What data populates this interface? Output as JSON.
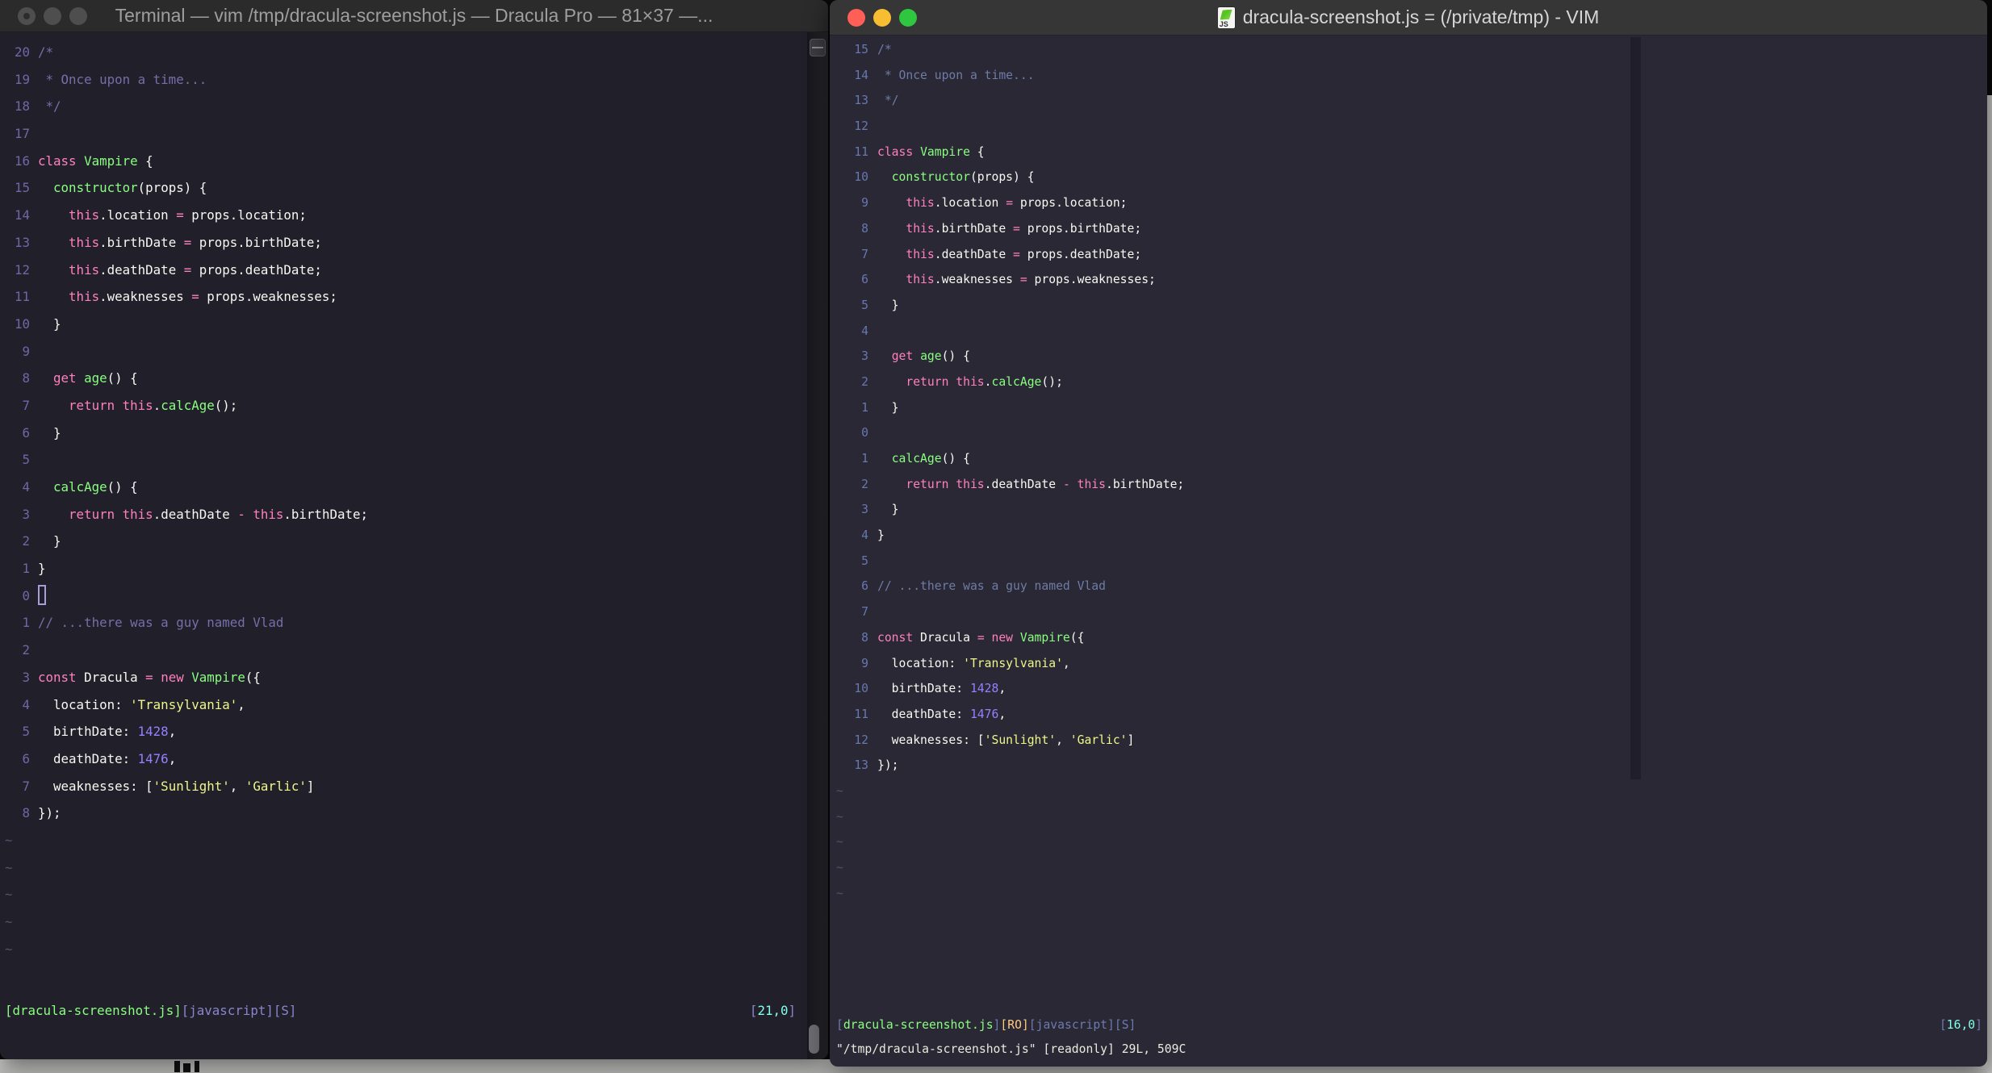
{
  "colors": {
    "bg_left": "#201f2a",
    "bg_right": "#292834",
    "fg": "#f8f8f2",
    "pink": "#ff80bf",
    "green": "#8aff80",
    "yellow": "#eef78a",
    "purple": "#9580ff",
    "cyan": "#80ffea",
    "orange": "#ffca80",
    "comment_left": "#766fa8",
    "comment_right": "#6e7ca6",
    "linenr_left": "#6f68a5",
    "linenr_right": "#6877b0",
    "lavender": "#8a85cc",
    "status_blue": "#6d7ab0",
    "tilde_left": "#54516a",
    "tilde_right": "#4b5270",
    "titlebar_left": "#2c2b2b",
    "titlebar_right": "#373636",
    "colorcolumn": "#211e2b"
  },
  "left_window": {
    "title": "Terminal — vim /tmp/dracula-screenshot.js — Dracula Pro — 81×37 —...",
    "status_tokens": [
      [
        "g",
        "[dracula-screenshot.js]"
      ],
      [
        "lav",
        "[javascript][S]"
      ]
    ],
    "position_tokens": [
      [
        "lav",
        "["
      ],
      [
        "cy",
        "21,0"
      ],
      [
        "lav",
        "]"
      ]
    ],
    "tilde_count": 5,
    "cursor_line_index": 20
  },
  "right_window": {
    "title": "dracula-screenshot.js = (/private/tmp) - VIM",
    "status_tokens": [
      [
        "b",
        "["
      ],
      [
        "g",
        "dracula-screenshot.js"
      ],
      [
        "b",
        "]"
      ],
      [
        "o",
        "[RO]"
      ],
      [
        "b",
        "[javascript][S]"
      ]
    ],
    "position_tokens": [
      [
        "b",
        "["
      ],
      [
        "cy",
        "16,0"
      ],
      [
        "b",
        "]"
      ]
    ],
    "message_line": "\"/tmp/dracula-screenshot.js\" [readonly] 29L, 509C",
    "tilde_count": 5,
    "cursor_visible": false
  },
  "tilde_glyph": "~",
  "code": {
    "lines": [
      {
        "l": "20",
        "r": "15",
        "tokens": [
          [
            "c",
            "/*"
          ]
        ]
      },
      {
        "l": "19",
        "r": "14",
        "tokens": [
          [
            "c",
            " * Once upon a time..."
          ]
        ]
      },
      {
        "l": "18",
        "r": "13",
        "tokens": [
          [
            "c",
            " */"
          ]
        ]
      },
      {
        "l": "17",
        "r": "12",
        "tokens": []
      },
      {
        "l": "16",
        "r": "11",
        "tokens": [
          [
            "p",
            "class"
          ],
          [
            "n",
            " "
          ],
          [
            "g",
            "Vampire"
          ],
          [
            "n",
            " {"
          ]
        ]
      },
      {
        "l": "15",
        "r": "10",
        "tokens": [
          [
            "n",
            "  "
          ],
          [
            "g",
            "constructor"
          ],
          [
            "n",
            "(props) {"
          ]
        ]
      },
      {
        "l": "14",
        "r": "9",
        "tokens": [
          [
            "n",
            "    "
          ],
          [
            "p",
            "this"
          ],
          [
            "n",
            ".location "
          ],
          [
            "p",
            "="
          ],
          [
            "n",
            " props.location;"
          ]
        ]
      },
      {
        "l": "13",
        "r": "8",
        "tokens": [
          [
            "n",
            "    "
          ],
          [
            "p",
            "this"
          ],
          [
            "n",
            ".birthDate "
          ],
          [
            "p",
            "="
          ],
          [
            "n",
            " props.birthDate;"
          ]
        ]
      },
      {
        "l": "12",
        "r": "7",
        "tokens": [
          [
            "n",
            "    "
          ],
          [
            "p",
            "this"
          ],
          [
            "n",
            ".deathDate "
          ],
          [
            "p",
            "="
          ],
          [
            "n",
            " props.deathDate;"
          ]
        ]
      },
      {
        "l": "11",
        "r": "6",
        "tokens": [
          [
            "n",
            "    "
          ],
          [
            "p",
            "this"
          ],
          [
            "n",
            ".weaknesses "
          ],
          [
            "p",
            "="
          ],
          [
            "n",
            " props.weaknesses;"
          ]
        ]
      },
      {
        "l": "10",
        "r": "5",
        "tokens": [
          [
            "n",
            "  }"
          ]
        ]
      },
      {
        "l": "9",
        "r": "4",
        "tokens": []
      },
      {
        "l": "8",
        "r": "3",
        "tokens": [
          [
            "n",
            "  "
          ],
          [
            "p",
            "get"
          ],
          [
            "n",
            " "
          ],
          [
            "g",
            "age"
          ],
          [
            "n",
            "() {"
          ]
        ]
      },
      {
        "l": "7",
        "r": "2",
        "tokens": [
          [
            "n",
            "    "
          ],
          [
            "p",
            "return"
          ],
          [
            "n",
            " "
          ],
          [
            "p",
            "this"
          ],
          [
            "n",
            "."
          ],
          [
            "g",
            "calcAge"
          ],
          [
            "n",
            "();"
          ]
        ]
      },
      {
        "l": "6",
        "r": "1",
        "tokens": [
          [
            "n",
            "  }"
          ]
        ]
      },
      {
        "l": "5",
        "r": "0",
        "tokens": []
      },
      {
        "l": "4",
        "r": "1",
        "tokens": [
          [
            "n",
            "  "
          ],
          [
            "g",
            "calcAge"
          ],
          [
            "n",
            "() {"
          ]
        ]
      },
      {
        "l": "3",
        "r": "2",
        "tokens": [
          [
            "n",
            "    "
          ],
          [
            "p",
            "return"
          ],
          [
            "n",
            " "
          ],
          [
            "p",
            "this"
          ],
          [
            "n",
            ".deathDate "
          ],
          [
            "p",
            "-"
          ],
          [
            "n",
            " "
          ],
          [
            "p",
            "this"
          ],
          [
            "n",
            ".birthDate;"
          ]
        ]
      },
      {
        "l": "2",
        "r": "3",
        "tokens": [
          [
            "n",
            "  }"
          ]
        ]
      },
      {
        "l": "1",
        "r": "4",
        "tokens": [
          [
            "n",
            "}"
          ]
        ]
      },
      {
        "l": "0",
        "r": "5",
        "tokens": []
      },
      {
        "l": "1",
        "r": "6",
        "tokens": [
          [
            "c",
            "// ...there was a guy named Vlad"
          ]
        ]
      },
      {
        "l": "2",
        "r": "7",
        "tokens": []
      },
      {
        "l": "3",
        "r": "8",
        "tokens": [
          [
            "p",
            "const"
          ],
          [
            "n",
            " Dracula "
          ],
          [
            "p",
            "="
          ],
          [
            "n",
            " "
          ],
          [
            "p",
            "new"
          ],
          [
            "n",
            " "
          ],
          [
            "g",
            "Vampire"
          ],
          [
            "n",
            "({"
          ]
        ]
      },
      {
        "l": "4",
        "r": "9",
        "tokens": [
          [
            "n",
            "  location: "
          ],
          [
            "y",
            "'Transylvania'"
          ],
          [
            "n",
            ","
          ]
        ]
      },
      {
        "l": "5",
        "r": "10",
        "tokens": [
          [
            "n",
            "  birthDate: "
          ],
          [
            "u",
            "1428"
          ],
          [
            "n",
            ","
          ]
        ]
      },
      {
        "l": "6",
        "r": "11",
        "tokens": [
          [
            "n",
            "  deathDate: "
          ],
          [
            "u",
            "1476"
          ],
          [
            "n",
            ","
          ]
        ]
      },
      {
        "l": "7",
        "r": "12",
        "tokens": [
          [
            "n",
            "  weaknesses: ["
          ],
          [
            "y",
            "'Sunlight'"
          ],
          [
            "n",
            ", "
          ],
          [
            "y",
            "'Garlic'"
          ],
          [
            "n",
            "]"
          ]
        ]
      },
      {
        "l": "8",
        "r": "13",
        "tokens": [
          [
            "n",
            "});"
          ]
        ]
      }
    ]
  }
}
